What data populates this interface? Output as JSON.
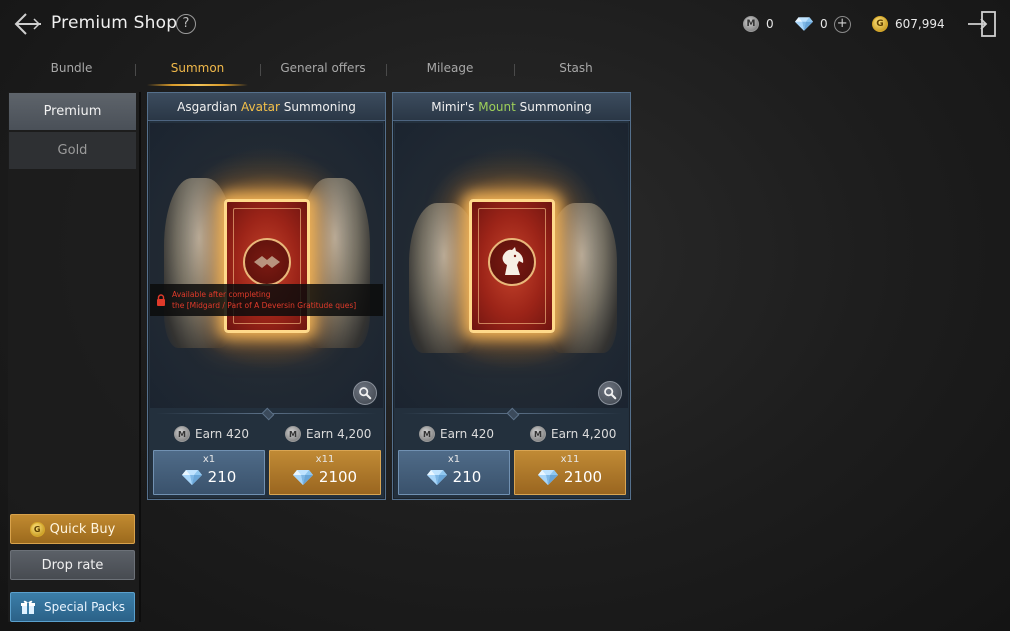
{
  "header": {
    "title": "Premium Shop",
    "help": "?",
    "mileage_symbol": "M",
    "mileage_value": "0",
    "diamond_value": "0",
    "add_symbol": "+",
    "gold_symbol": "G",
    "gold_value": "607,994"
  },
  "tabs": [
    "Bundle",
    "Summon",
    "General offers",
    "Mileage",
    "Stash"
  ],
  "active_tab": "Summon",
  "sidebar": {
    "tabs": [
      "Premium",
      "Gold"
    ],
    "active": "Premium",
    "quick_buy": "Quick Buy",
    "drop_rate": "Drop rate",
    "special_packs": "Special Packs"
  },
  "cards": [
    {
      "title_prefix": "Asgardian ",
      "title_highlight": "Avatar",
      "title_suffix": " Summoning",
      "locked_line1": "Available after completing",
      "locked_line2": "the [Midgard / Part of A Deversin Gratitude ques]",
      "earn1": "Earn 420",
      "earn2": "Earn 4,200",
      "buy1": {
        "qty": "x1",
        "price": "210"
      },
      "buy2": {
        "qty": "x11",
        "price": "2100"
      }
    },
    {
      "title_prefix": "Mimir's ",
      "title_highlight": "Mount",
      "title_suffix": " Summoning",
      "earn1": "Earn 420",
      "earn2": "Earn 4,200",
      "buy1": {
        "qty": "x1",
        "price": "210"
      },
      "buy2": {
        "qty": "x11",
        "price": "2100"
      }
    }
  ],
  "colors": {
    "accent_gold": "#f3c04a",
    "accent_green": "#9ed05a",
    "lock_red": "#e03a2a",
    "active_tab": "#f0b84a"
  },
  "icons": [
    "back-arrow-icon",
    "help-icon",
    "mileage-coin-icon",
    "diamond-icon",
    "plus-icon",
    "gold-coin-icon",
    "exit-icon",
    "lock-icon",
    "magnifier-icon",
    "gift-icon",
    "horse-head-icon"
  ]
}
